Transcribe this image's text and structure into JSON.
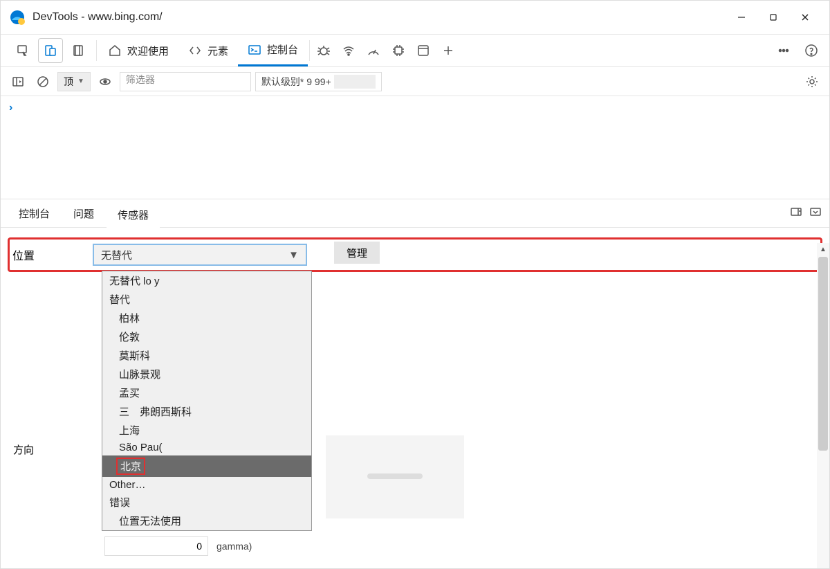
{
  "title": "DevTools - www.bing.com/",
  "top_tabs": {
    "welcome": "欢迎使用",
    "elements": "元素",
    "console": "控制台"
  },
  "filterbar": {
    "context": "顶",
    "filter_placeholder": "筛选器",
    "levels": "默认级别* 9 99+"
  },
  "drawer_tabs": {
    "console": "控制台",
    "issues": "问题",
    "sensors": "传感器"
  },
  "sensors": {
    "location_label": "位置",
    "location_value": "无替代",
    "manage": "管理",
    "orientation_label": "方向",
    "gamma_label": "gamma)",
    "gamma_value": "0"
  },
  "dropdown": {
    "no_override": "无替代 lo y",
    "override": "替代",
    "berlin": "柏林",
    "london": "伦敦",
    "moscow": "莫斯科",
    "mountain": "山脉景观",
    "mumbai": "孟买",
    "sf": "三　弗朗西斯科",
    "shanghai": "上海",
    "saopaulo": "São Pau(",
    "beijing": "北京",
    "other": "Other…",
    "error": "错误",
    "unavailable": "位置无法使用"
  }
}
